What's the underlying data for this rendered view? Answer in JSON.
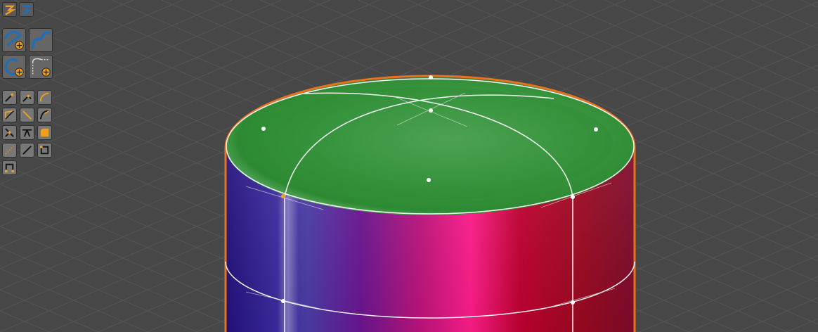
{
  "viewport": {
    "background": "#474747",
    "grid_color": "#555555",
    "selection_outline_color": "#e8731f",
    "object": "cylinder",
    "top_face_color": "#2f8f34",
    "side_gradient_colors": [
      "#2a0a6e",
      "#5a1c8a",
      "#e0186e",
      "#a6001a",
      "#800c28"
    ]
  },
  "toolbar": {
    "top_icons": [
      "sequencer-small-icon",
      "blueprint-small-icon"
    ],
    "create_tools": [
      "spline-pen-add-tool",
      "spline-freehand-add-tool",
      "circle-add-tool",
      "bezier-point-add-tool"
    ],
    "edit_tools": [
      "move-point-tool",
      "pivot-point-tool",
      "arc-tool",
      "bend-point-tool",
      "straight-line-tool",
      "curve-tool",
      "cut-point-tool",
      "bridge-tool",
      "fillet-tool",
      "dotted-line-tool",
      "diagonal-line-tool",
      "square-select-tool",
      "connect-points-tool"
    ],
    "accent_color": "#f0a020",
    "icon_color": "#1e6fb8"
  }
}
